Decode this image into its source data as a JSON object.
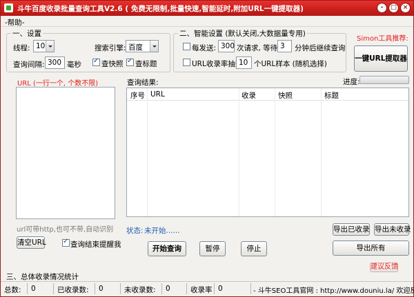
{
  "window": {
    "title": "斗牛百度收录批量查询工具V2.6 ( 免费无限制,批量快速,智能延时,附加URL一键提取器)",
    "min_glyph": "-",
    "max_glyph": "□",
    "close_glyph": "×"
  },
  "menu": {
    "help": "-帮助-"
  },
  "settings": {
    "group_title": "一、设置",
    "threads_label": "线程:",
    "threads_value": "10",
    "engine_label": "搜索引擎:",
    "engine_value": "百度",
    "interval_label": "查询间隔:",
    "interval_value": "300",
    "interval_unit": "毫秒",
    "check_snapshot": "查快照",
    "check_title": "查标题"
  },
  "smart": {
    "group_title": "二、智能设置 (默认关闭,大数据量专用)",
    "every_label": "每发送:",
    "every_value": "300",
    "wait_label": "次请求, 等待:",
    "wait_value": "3",
    "resume_label": "分钟后继续查询",
    "sample_label": "URL收录率抽查:",
    "sample_value": "10",
    "sample_suffix": "个URL样本 (随机选择)"
  },
  "simon": {
    "label": "Simon工具推荐:",
    "extract_button": "一键URL提取器"
  },
  "url_panel": {
    "label": "URL (一行一个, 个数不限)",
    "hint": "url可带http,也可不带,自动识别",
    "clear_button": "清空URL",
    "remind_label": "查询结束提醒我"
  },
  "results": {
    "label": "查询结果:",
    "progress_label": "进度:",
    "progress_fraction": 0,
    "columns": [
      "序号",
      "URL",
      "收录",
      "快照",
      "标题"
    ],
    "status_prefix": "状态:",
    "status_value": "未开始......"
  },
  "buttons": {
    "start": "开始查询",
    "pause": "暂停",
    "stop": "停止",
    "export_indexed": "导出已收录",
    "export_unindexed": "导出未收录",
    "export_all": "导出所有",
    "feedback": "建议反馈"
  },
  "stats": {
    "group_title": "三、总体收录情况统计"
  },
  "statusbar": {
    "total_label": "总数:",
    "total_value": "0",
    "indexed_label": "已收录数:",
    "indexed_value": "0",
    "unindexed_label": "未收录数:",
    "unindexed_value": "0",
    "rate_label": "收录率",
    "rate_value": "0",
    "site_text": "- 斗牛SEO工具官网 : http://www.douniu.la/ 欢迎反馈 !"
  }
}
